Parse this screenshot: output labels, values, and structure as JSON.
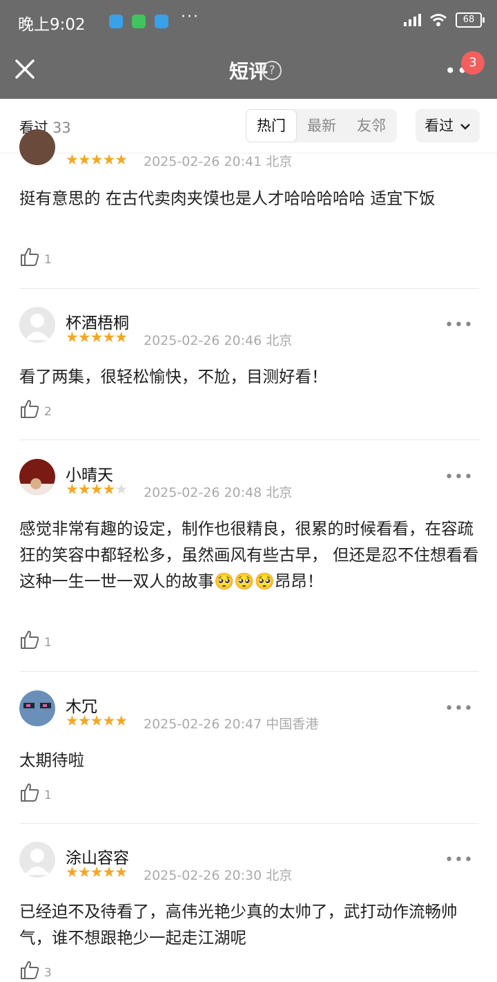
{
  "status": {
    "time": "晚上9:02",
    "battery": "68",
    "more_dots": "···"
  },
  "nav": {
    "title": "短评",
    "help": "?",
    "badge": "3",
    "more": "••"
  },
  "filter": {
    "seen_label": "看过",
    "seen_count": "33",
    "tabs": [
      "热门",
      "最新",
      "友邻"
    ],
    "dropdown_label": "看过"
  },
  "reviews": [
    {
      "user": "",
      "rating": 5,
      "time": "2025-02-26 20:41",
      "location": "北京",
      "text": "挺有意思的 在古代卖肉夹馍也是人才哈哈哈哈哈 适宜下饭",
      "likes": "1"
    },
    {
      "user": "杯酒梧桐",
      "rating": 5,
      "time": "2025-02-26 20:46",
      "location": "北京",
      "text": "看了两集，很轻松愉快，不尬，目测好看！",
      "likes": "2"
    },
    {
      "user": "小晴天",
      "rating": 4,
      "time": "2025-02-26 20:48",
      "location": "北京",
      "text": "感觉非常有趣的设定，制作也很精良，很累的时候看看，在容疏狂的笑容中都轻松多，虽然画风有些古早， 但还是忍不住想看看这种一生一世一双人的故事🥺🥺🥺昂昂！",
      "likes": "1"
    },
    {
      "user": "木冗",
      "rating": 5,
      "time": "2025-02-26 20:47",
      "location": "中国香港",
      "text": "太期待啦",
      "likes": "1"
    },
    {
      "user": "涂山容容",
      "rating": 5,
      "time": "2025-02-26 20:30",
      "location": "北京",
      "text": "已经迫不及待看了，高伟光艳少真的太帅了，武打动作流畅帅气，谁不想跟艳少一起走江湖呢",
      "likes": "3"
    }
  ],
  "card_menu": "•••",
  "colors": {
    "header": "#6b6b6b",
    "star": "#f5a623",
    "badge": "#f25f5c"
  }
}
